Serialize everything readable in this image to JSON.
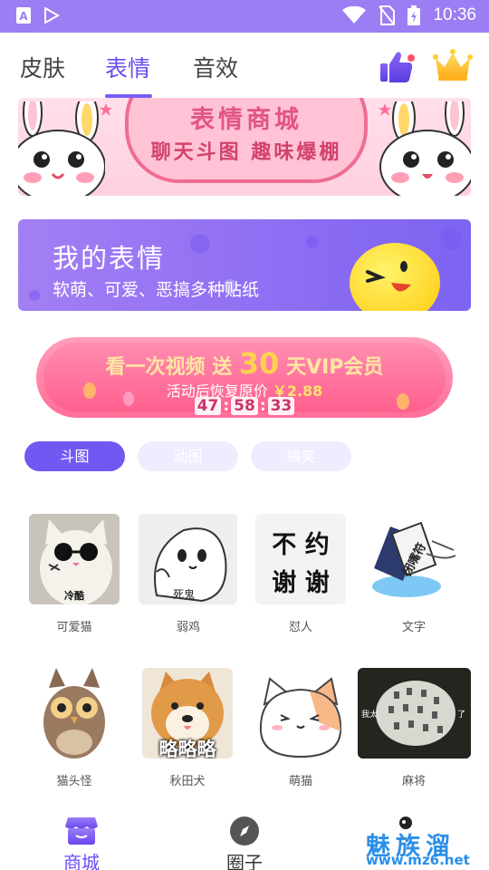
{
  "status_bar": {
    "time": "10:36",
    "left_icons": [
      "app-store-icon",
      "play-store-icon"
    ],
    "right_icons": [
      "wifi-icon",
      "no-sim-icon",
      "battery-charging-icon"
    ]
  },
  "top_tabs": [
    {
      "label": "皮肤",
      "active": false
    },
    {
      "label": "表情",
      "active": true
    },
    {
      "label": "音效",
      "active": false
    }
  ],
  "top_icons": [
    "thumbs-up-icon",
    "crown-icon"
  ],
  "banner": {
    "title": "表情商城",
    "subtitle": "聊天斗图 趣味爆棚"
  },
  "my_stickers": {
    "title": "我的表情",
    "subtitle": "软萌、可爱、恶搞多种贴纸"
  },
  "vip_promo": {
    "headline_prefix": "看一次视频 送",
    "headline_number": "30",
    "headline_suffix": "天VIP会员",
    "sub_prefix": "活动后恢复原价",
    "price": "￥2.88",
    "timer": [
      "47",
      "58",
      "33"
    ]
  },
  "chips": [
    {
      "label": "斗图",
      "active": true
    },
    {
      "label": "动图",
      "active": false
    },
    {
      "label": "搞笑",
      "active": false
    }
  ],
  "stickers": [
    {
      "label": "可爱猫",
      "overlay": "冷酷"
    },
    {
      "label": "弱鸡",
      "overlay": "死鬼"
    },
    {
      "label": "怼人",
      "overlay_lines": [
        "不 约",
        "谢 谢"
      ]
    },
    {
      "label": "文字",
      "overlay": "闭嘴符"
    },
    {
      "label": "猫头怪"
    },
    {
      "label": "秋田犬",
      "overlay": "略略略"
    },
    {
      "label": "萌猫"
    },
    {
      "label": "麻将",
      "overlay_left": "我太",
      "overlay_right": "了"
    }
  ],
  "bottom_nav": [
    {
      "label": "商城",
      "active": true,
      "icon": "store-icon"
    },
    {
      "label": "圈子",
      "active": false,
      "icon": "compass-icon"
    }
  ],
  "watermark": {
    "text": "魅族溜",
    "url": "www.mz6.net"
  },
  "colors": {
    "accent": "#7258f3",
    "status_bar": "#9b7ef3",
    "active_tab": "#6a4bf0",
    "vip_pink": "#ff6f98"
  }
}
